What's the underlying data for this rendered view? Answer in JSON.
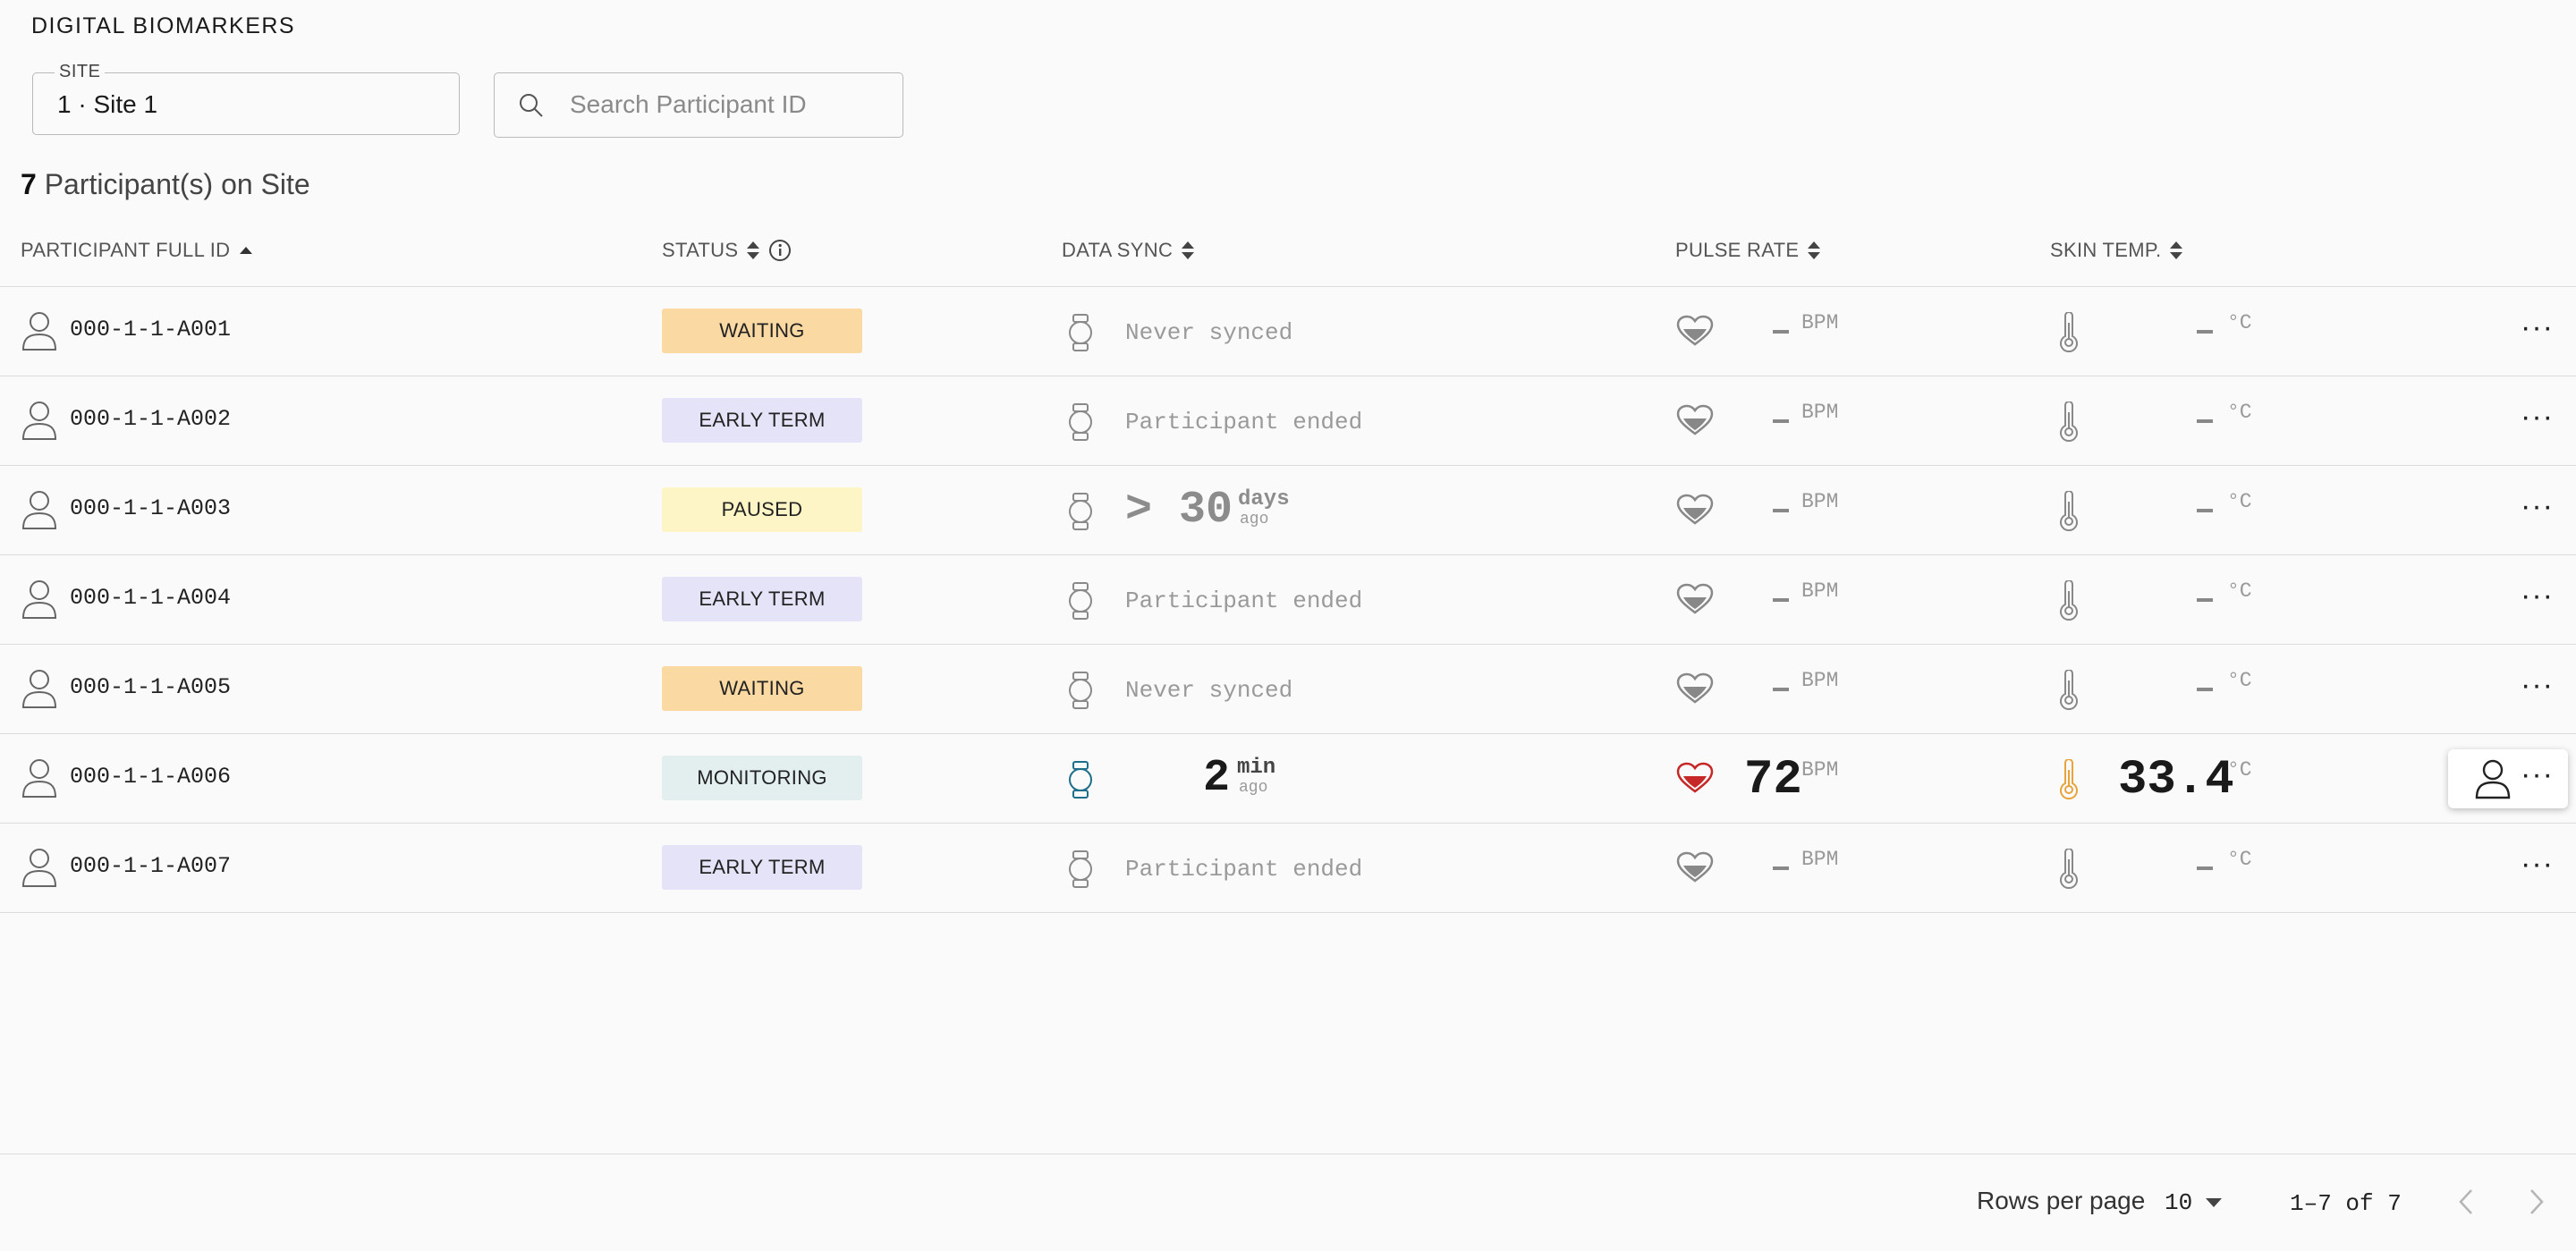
{
  "app": {
    "title": "DIGITAL BIOMARKERS"
  },
  "filters": {
    "site_label": "SITE",
    "site_value": "1 · Site 1",
    "search_placeholder": "Search Participant ID",
    "search_value": ""
  },
  "summary": {
    "count": "7",
    "text": "Participant(s) on Site"
  },
  "columns": {
    "participant": "PARTICIPANT FULL ID",
    "status": "STATUS",
    "data_sync": "DATA SYNC",
    "pulse_rate": "PULSE RATE",
    "skin_temp": "SKIN TEMP."
  },
  "units": {
    "bpm": "BPM",
    "celsius": "°C",
    "ago": "ago"
  },
  "colors": {
    "waiting": "#fad9a3",
    "early_term": "#e4e3f8",
    "paused": "#fdf5c6",
    "monitoring": "#e3eeee",
    "heart_active": "#c62828",
    "thermo_active": "#e8a33c",
    "watch_active": "#1f6e8c"
  },
  "rows": [
    {
      "id": "000-1-1-A001",
      "status": "WAITING",
      "sync_text": "Never synced",
      "pulse": "",
      "temp": ""
    },
    {
      "id": "000-1-1-A002",
      "status": "EARLY TERM",
      "sync_text": "Participant ended",
      "pulse": "",
      "temp": ""
    },
    {
      "id": "000-1-1-A003",
      "status": "PAUSED",
      "sync_prefix": ">",
      "sync_value": "30",
      "sync_unit": "days",
      "pulse": "",
      "temp": ""
    },
    {
      "id": "000-1-1-A004",
      "status": "EARLY TERM",
      "sync_text": "Participant ended",
      "pulse": "",
      "temp": ""
    },
    {
      "id": "000-1-1-A005",
      "status": "WAITING",
      "sync_text": "Never synced",
      "pulse": "",
      "temp": ""
    },
    {
      "id": "000-1-1-A006",
      "status": "MONITORING",
      "sync_value": "2",
      "sync_unit": "min",
      "pulse": "72",
      "temp": "33.4"
    },
    {
      "id": "000-1-1-A007",
      "status": "EARLY TERM",
      "sync_text": "Participant ended",
      "pulse": "",
      "temp": ""
    }
  ],
  "pagination": {
    "rows_per_page_label": "Rows per page",
    "rows_per_page_value": "10",
    "range": "1–7 of 7"
  },
  "icons": [
    "person-icon",
    "search-icon",
    "sort-icon",
    "info-icon",
    "watch-icon",
    "heart-icon",
    "thermometer-icon",
    "more-icon",
    "chevron-left-icon",
    "chevron-right-icon",
    "caret-down-icon"
  ]
}
